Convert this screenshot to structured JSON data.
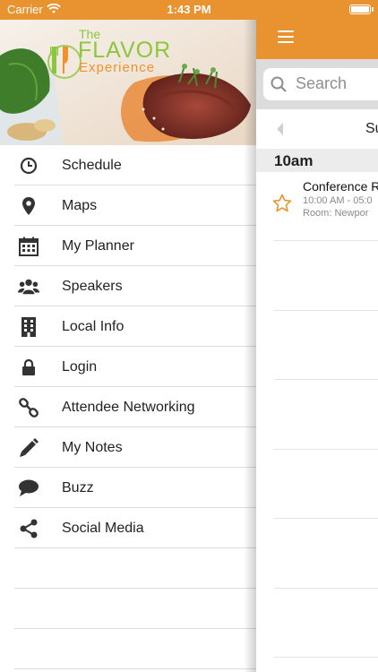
{
  "status_bar": {
    "carrier": "Carrier",
    "time": "1:43 PM"
  },
  "banner": {
    "logo_line1": "The",
    "logo_line2": "FLAVOR",
    "logo_line3": "Experience"
  },
  "menu": {
    "items": [
      {
        "label": "Schedule",
        "icon": "clock-icon"
      },
      {
        "label": "Maps",
        "icon": "map-pin-icon"
      },
      {
        "label": "My Planner",
        "icon": "calendar-icon"
      },
      {
        "label": "Speakers",
        "icon": "people-icon"
      },
      {
        "label": "Local Info",
        "icon": "building-icon"
      },
      {
        "label": "Login",
        "icon": "lock-icon"
      },
      {
        "label": "Attendee Networking",
        "icon": "link-icon"
      },
      {
        "label": "My Notes",
        "icon": "pencil-icon"
      },
      {
        "label": "Buzz",
        "icon": "speech-bubble-icon"
      },
      {
        "label": "Social Media",
        "icon": "share-icon"
      }
    ]
  },
  "main": {
    "search_placeholder": "Search",
    "day_label": "Su",
    "time_header": "10am",
    "sessions": [
      {
        "title": "Conference R",
        "time": "10:00 AM - 05:0",
        "room": "Room: Newpor"
      }
    ]
  },
  "colors": {
    "accent": "#e8932f",
    "logo_green": "#8cc63f",
    "logo_orange": "#f0922b"
  }
}
